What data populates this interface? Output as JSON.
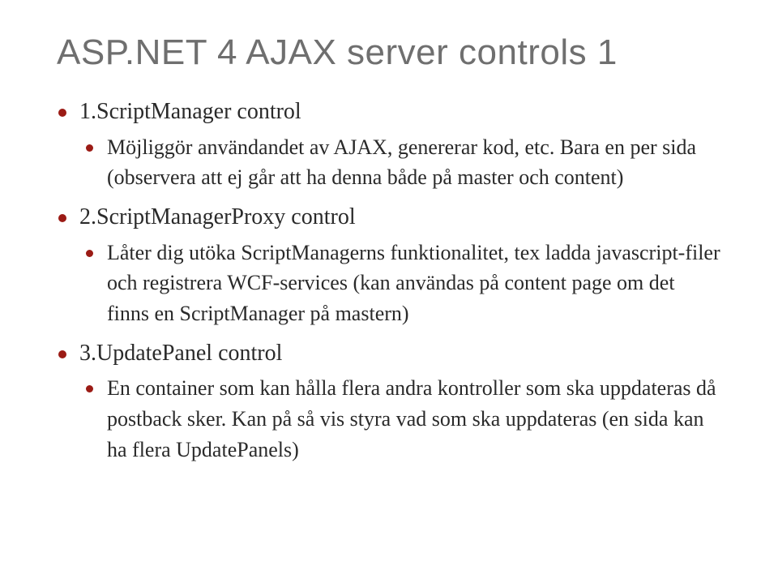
{
  "title": "ASP.NET 4 AJAX server controls 1",
  "items": [
    {
      "label": "1.ScriptManager control",
      "sub": [
        "Möjliggör användandet av AJAX, genererar kod, etc. Bara en per sida (observera att ej går att ha denna både på master och content)"
      ]
    },
    {
      "label": "2.ScriptManagerProxy control",
      "sub": [
        "Låter dig utöka ScriptManagerns funktionalitet, tex ladda javascript-filer och registrera WCF-services (kan användas på content page om det finns en ScriptManager på mastern)"
      ]
    },
    {
      "label": "3.UpdatePanel control",
      "sub": [
        "En container som kan hålla flera andra kontroller som ska uppdateras då postback sker. Kan på så vis styra vad som ska uppdateras (en sida kan ha flera UpdatePanels)"
      ]
    }
  ]
}
